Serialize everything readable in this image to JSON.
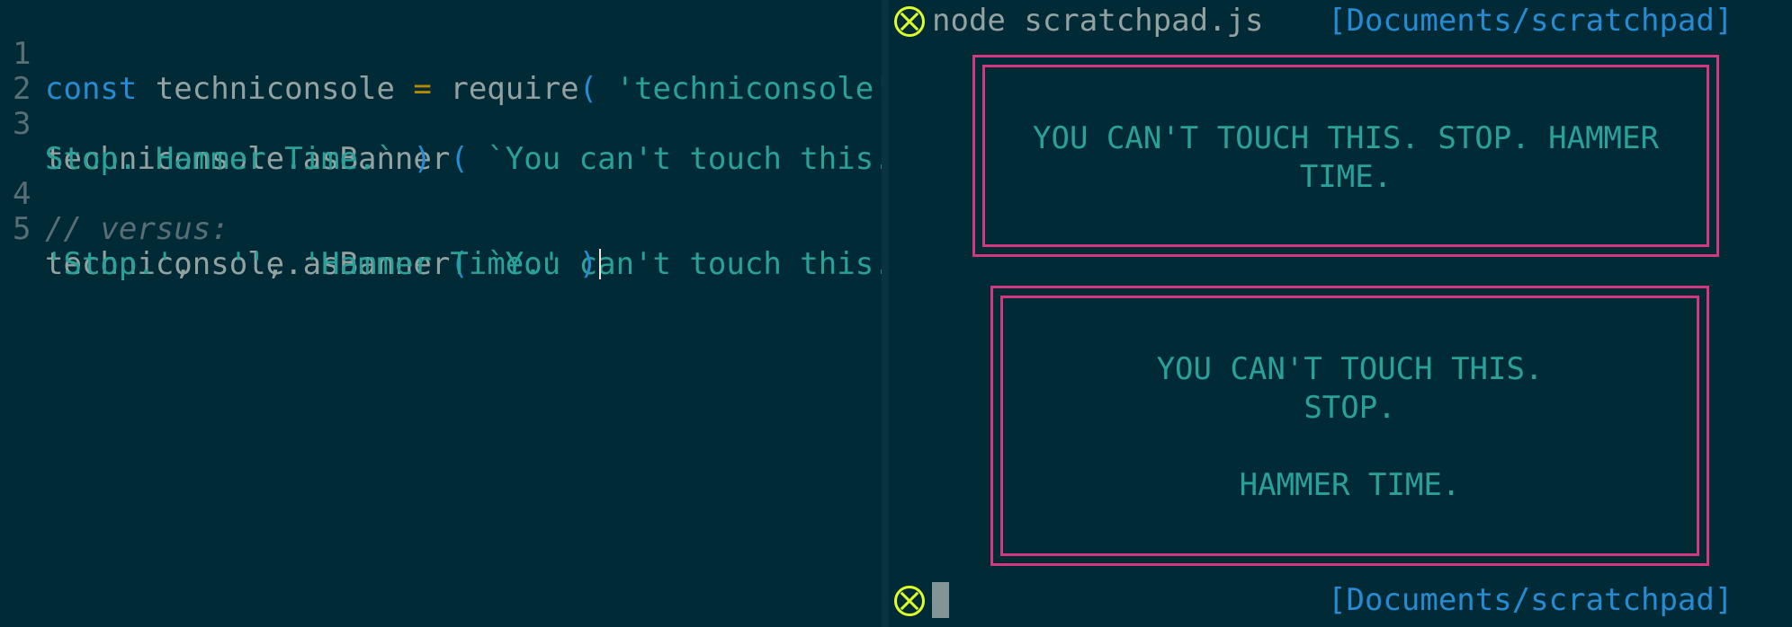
{
  "editor": {
    "lines": [
      {
        "number": "1",
        "tokens": {
          "kw": "const",
          "name": " techniconsole ",
          "op": "=",
          "fn": " require",
          "open": "( ",
          "str": "'techniconsole'",
          "close": " )"
        }
      },
      {
        "number": "2"
      },
      {
        "number": "3",
        "tokens": {
          "obj": "techniconsole.asBanner",
          "open": "( ",
          "str": "`You can't touch this."
        }
      },
      {
        "tokens": {
          "str": "Stop. Hammer Time.`",
          "close": " )"
        }
      },
      {
        "number": "4",
        "tokens": {
          "comment": "// versus:"
        }
      },
      {
        "number": "5",
        "tokens": {
          "obj": "techniconsole.asBanner",
          "open": "( ",
          "str": "`You can't touch this.`",
          "comma": ","
        }
      },
      {
        "tokens": {
          "str1": "'Stop.'",
          "comma1": ",  ",
          "str2": "''",
          "comma2": ", ",
          "str3": "'Hammer Time.'",
          "close": " )"
        }
      }
    ]
  },
  "terminal": {
    "command": "node scratchpad.js",
    "cwd_top": "[Documents/scratchpad]",
    "cwd_bottom": "[Documents/scratchpad]",
    "banner1_lines": [
      "YOU CAN'T TOUCH THIS. STOP. HAMMER",
      "TIME."
    ],
    "banner2_lines": [
      "YOU CAN'T TOUCH THIS.",
      "STOP.",
      "",
      "HAMMER TIME."
    ]
  },
  "colors": {
    "background": "#002b36",
    "keyword": "#268bd2",
    "string": "#2aa198",
    "operator": "#b58900",
    "comment": "#586e75",
    "banner_border": "#d33682",
    "status_icon": "#dfff2a"
  },
  "icons": {
    "status": "circle-x-icon"
  }
}
